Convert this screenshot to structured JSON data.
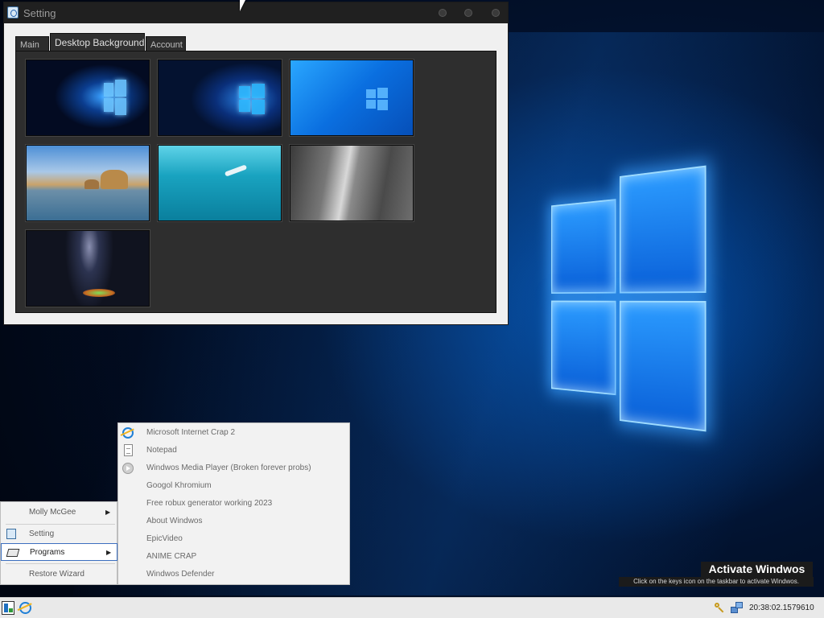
{
  "window": {
    "title": "Setting",
    "tabs": [
      {
        "label": "Main",
        "active": false
      },
      {
        "label": "Desktop Background",
        "active": true
      },
      {
        "label": "Account",
        "active": false
      }
    ],
    "wallpapers": [
      {
        "name": "windows-10-hero"
      },
      {
        "name": "windows-10-dark-blue"
      },
      {
        "name": "windows-10-light-blue"
      },
      {
        "name": "beach-rocks"
      },
      {
        "name": "underwater-swimmer"
      },
      {
        "name": "rock-cliff"
      },
      {
        "name": "milky-way-night"
      }
    ]
  },
  "start_menu": {
    "user": "Molly McGee",
    "items": [
      {
        "label": "Setting",
        "icon": "setting-icon"
      },
      {
        "label": "Programs",
        "icon": "programs-icon",
        "highlighted": true
      },
      {
        "label": "Restore Wizard"
      }
    ],
    "submenu_arrow": "▶"
  },
  "programs_menu": {
    "items": [
      {
        "label": "Microsoft Internet Crap 2",
        "icon": "internet-explorer-icon"
      },
      {
        "label": "Notepad",
        "icon": "notepad-icon"
      },
      {
        "label": "Windwos Media Player (Broken forever probs)",
        "icon": "media-player-icon"
      },
      {
        "label": "Googol Khromium"
      },
      {
        "label": "Free robux generator working 2023"
      },
      {
        "label": "About Windwos"
      },
      {
        "label": "EpicVideo"
      },
      {
        "label": "ANIME CRAP"
      },
      {
        "label": "Windwos Defender"
      }
    ]
  },
  "activation": {
    "title": "Activate Windwos",
    "subtitle": "Click on the keys icon on the taskbar to activate Windwos."
  },
  "taskbar": {
    "clock": "20:38:02.1579610",
    "icons": [
      "start-icon",
      "internet-explorer-icon",
      "keys-icon",
      "network-icon"
    ]
  },
  "colors": {
    "accent": "#3c6fbf",
    "desktop_blue": "#0a60d8",
    "titlebar": "#202020"
  }
}
